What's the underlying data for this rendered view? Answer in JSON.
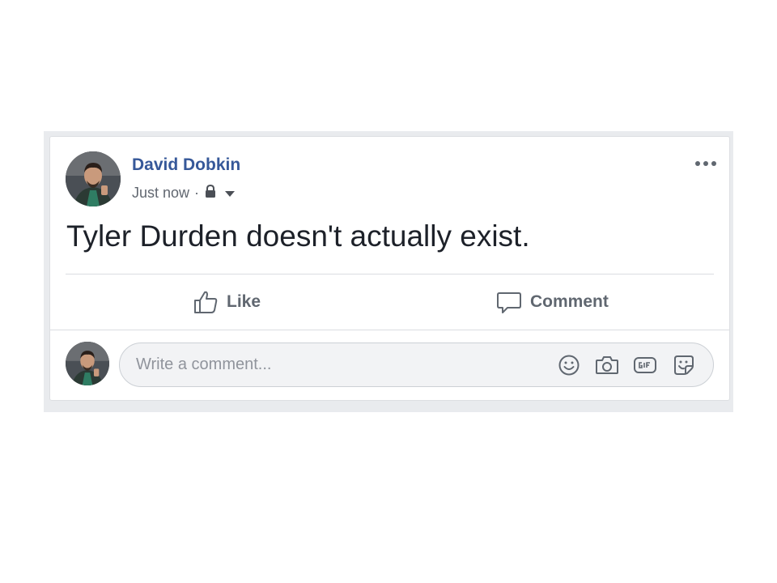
{
  "post": {
    "author": "David Dobkin",
    "timestamp": "Just now",
    "separator": "·",
    "privacy_icon": "lock-icon",
    "text": "Tyler Durden doesn't actually exist.",
    "more_icon": "more-options-icon"
  },
  "actions": {
    "like_label": "Like",
    "like_icon": "thumbs-up-icon",
    "comment_label": "Comment",
    "comment_icon": "speech-bubble-icon"
  },
  "composer": {
    "placeholder": "Write a comment...",
    "value": "",
    "tools": [
      "emoji-icon",
      "camera-icon",
      "gif-icon",
      "sticker-icon"
    ]
  },
  "colors": {
    "author_name": "#365899",
    "feed_background": "#e9ebee",
    "text": "#1d2129",
    "secondary_text": "#616770",
    "action_text": "#606770"
  }
}
